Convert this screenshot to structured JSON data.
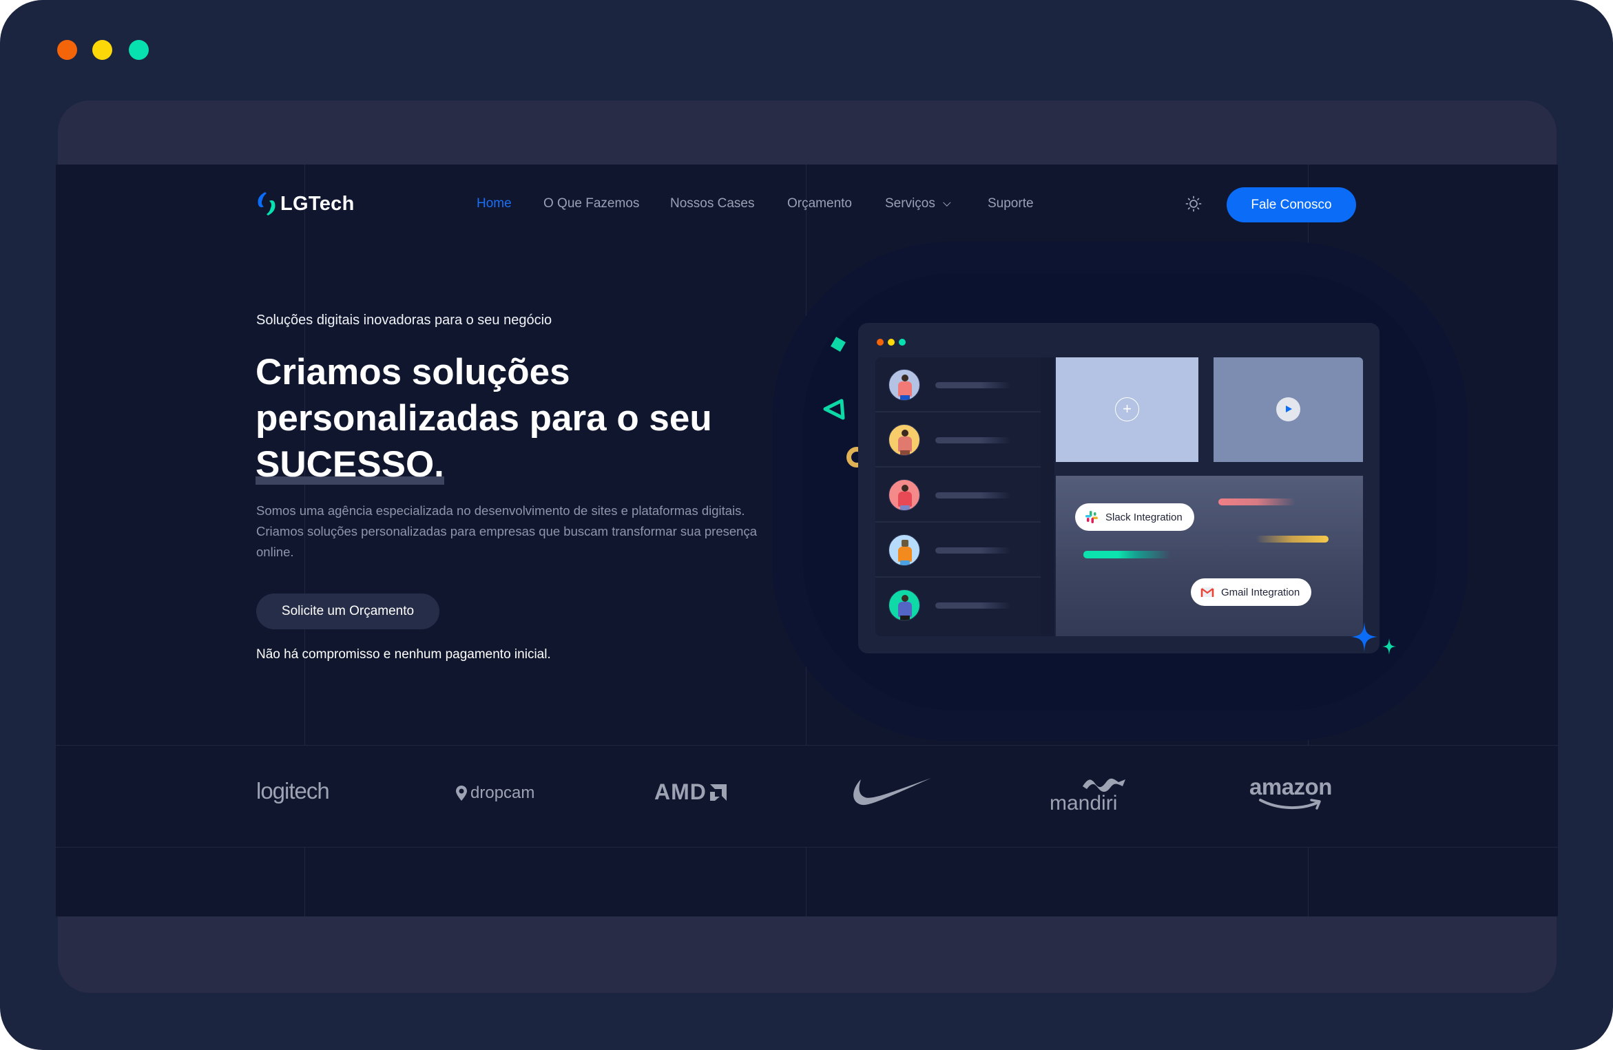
{
  "window": {
    "traffic_lights": [
      "close",
      "minimize",
      "maximize"
    ]
  },
  "nav": {
    "logo_text": "LGTech",
    "items": [
      {
        "label": "Home",
        "active": true
      },
      {
        "label": "O Que Fazemos",
        "active": false
      },
      {
        "label": "Nossos Cases",
        "active": false
      },
      {
        "label": "Orçamento",
        "active": false
      },
      {
        "label": "Serviços",
        "active": false,
        "has_dropdown": true
      },
      {
        "label": "Suporte",
        "active": false
      }
    ],
    "theme_toggle_icon": "sun-icon",
    "cta_label": "Fale Conosco"
  },
  "hero": {
    "kicker": "Soluções digitais inovadoras para o seu negócio",
    "headline_part1": "Criamos soluções personalizadas para o seu ",
    "headline_highlight": "SUCESSO.",
    "paragraph": "Somos uma agência especializada no desenvolvimento de sites e plataformas digitais. Criamos soluções personalizadas para empresas que buscam transformar sua presença online.",
    "cta_label": "Solicite um Orçamento",
    "note": "Não há compromisso e nenhum pagamento inicial."
  },
  "illustration": {
    "list_rows": 5,
    "tiles": [
      {
        "icon": "plus-icon"
      },
      {
        "icon": "play-icon"
      }
    ],
    "integrations": [
      {
        "label": "Slack Integration",
        "icon": "slack-icon"
      },
      {
        "label": "Gmail Integration",
        "icon": "gmail-icon"
      }
    ]
  },
  "logos": [
    {
      "name": "logitech",
      "text": "logitech"
    },
    {
      "name": "dropcam",
      "text": "dropcam"
    },
    {
      "name": "amd",
      "text": "AMD"
    },
    {
      "name": "nike",
      "text": ""
    },
    {
      "name": "mandiri",
      "text": "mandiri"
    },
    {
      "name": "amazon",
      "text": "amazon"
    }
  ],
  "colors": {
    "accent": "#0a6cf7",
    "teal": "#07e0af",
    "page_bg": "#10162e",
    "frame_bg": "#1c2540"
  }
}
